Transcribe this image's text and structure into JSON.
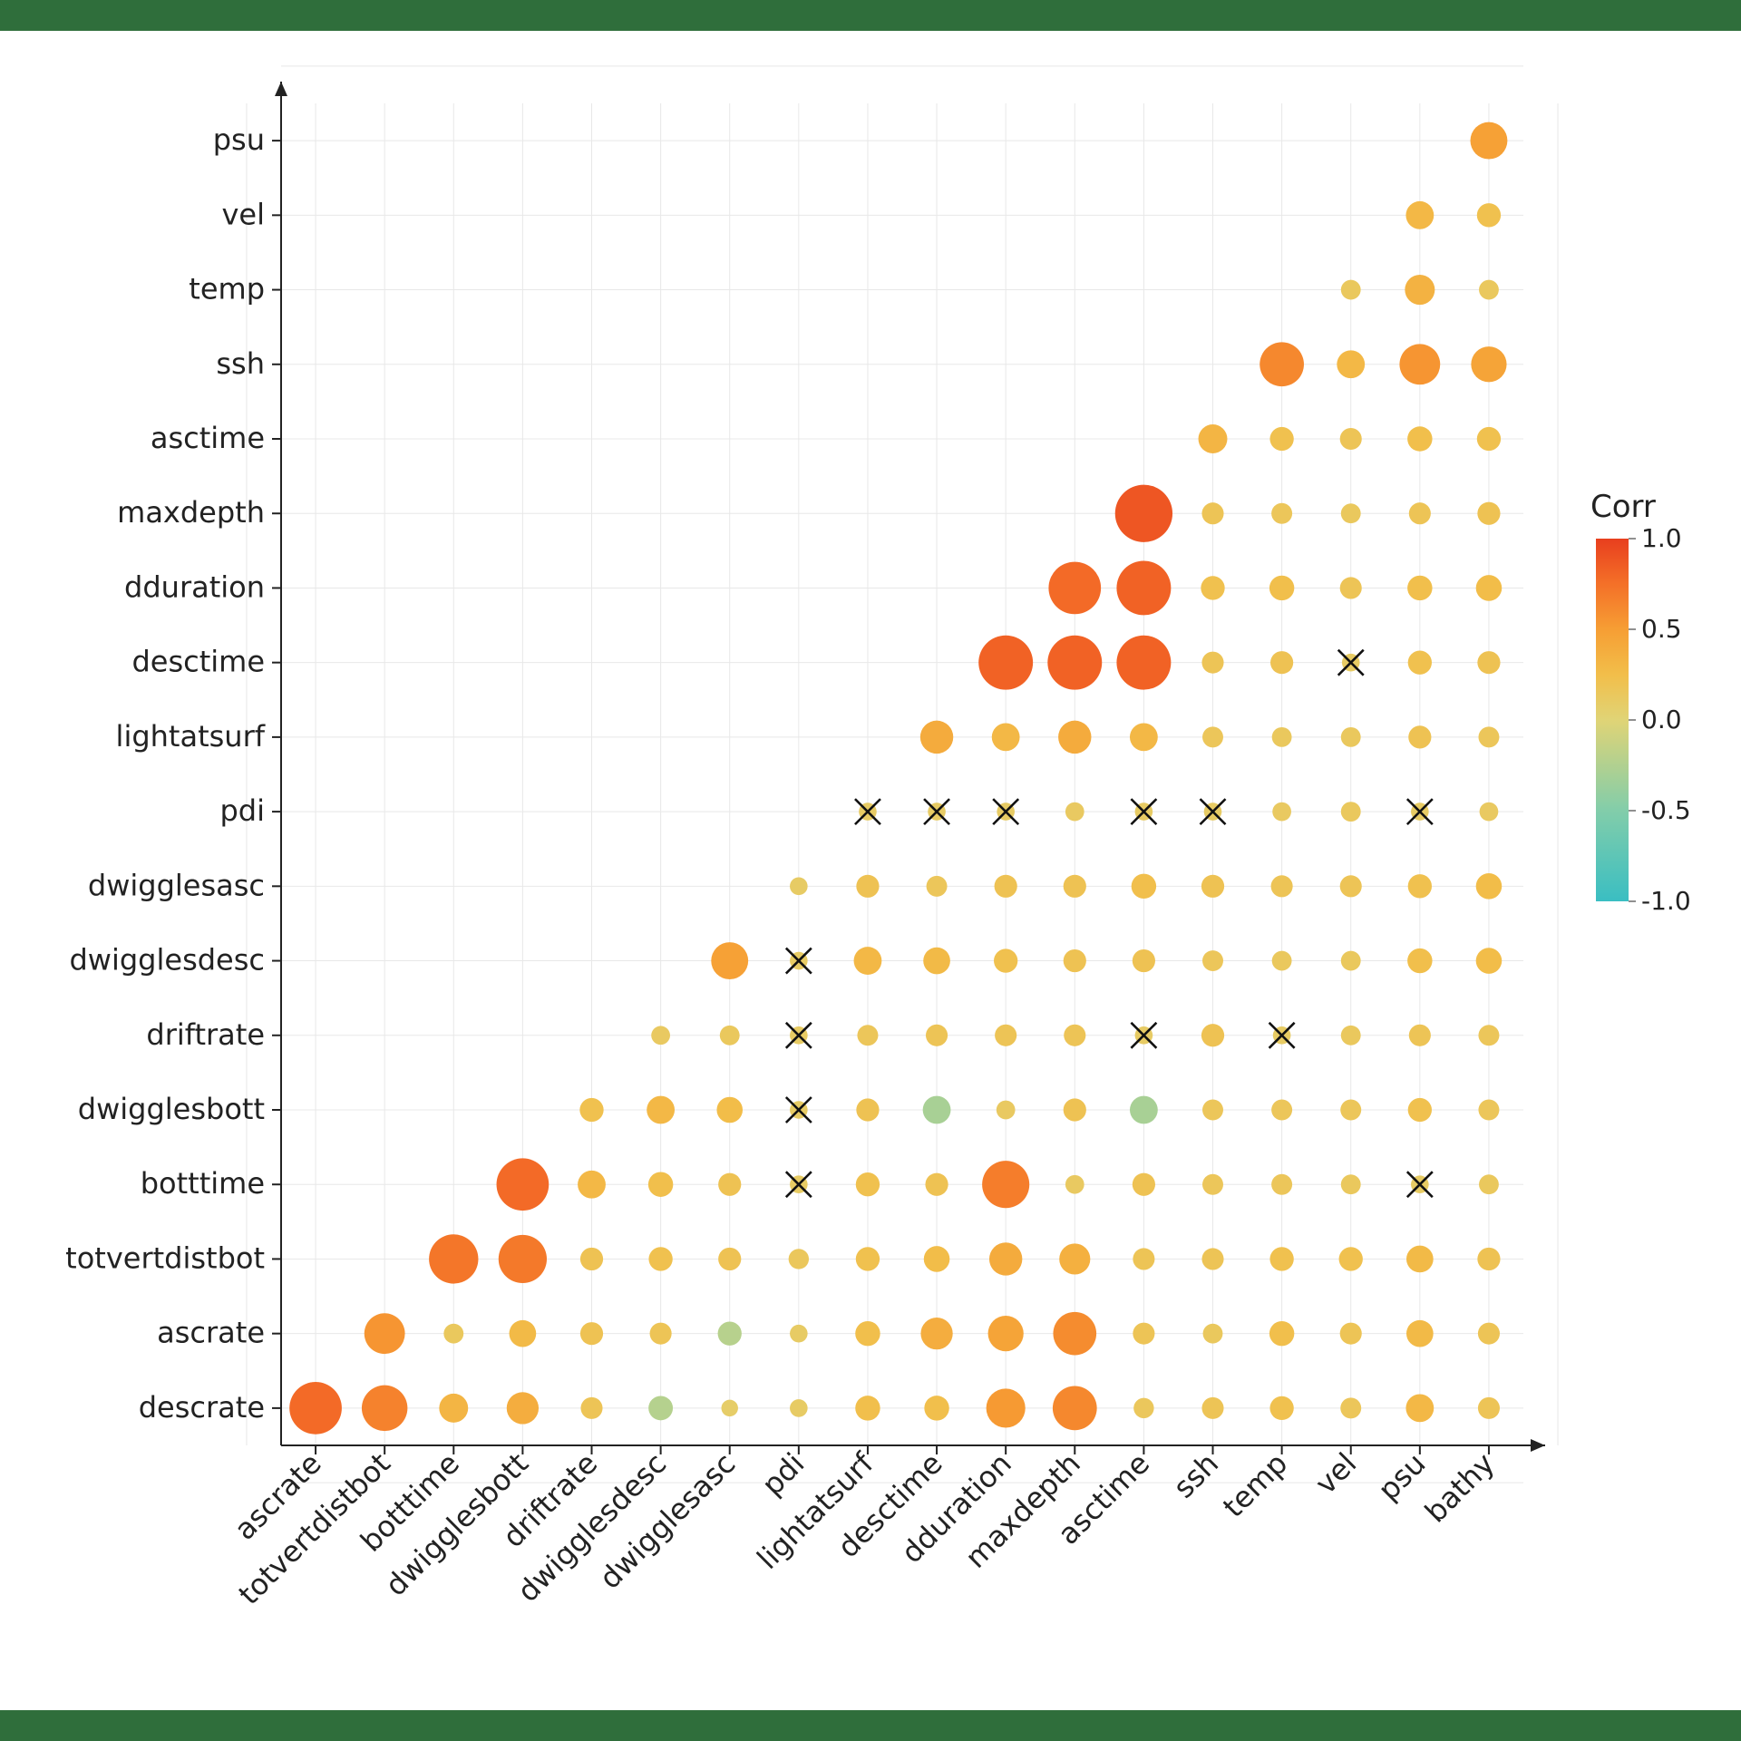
{
  "chart_data": {
    "type": "heatmap",
    "title": "",
    "xlabel": "",
    "ylabel": "",
    "legend_title": "Corr",
    "colorbar_ticks": [
      -1.0,
      -0.5,
      0.0,
      0.5,
      1.0
    ],
    "size_range_abs": [
      0.0,
      1.0
    ],
    "x_categories": [
      "ascrate",
      "totvertdistbot",
      "botttime",
      "dwigglesbott",
      "driftrate",
      "dwigglesdesc",
      "dwigglesasc",
      "pdi",
      "lightatsurf",
      "desctime",
      "dduration",
      "maxdepth",
      "asctime",
      "ssh",
      "temp",
      "vel",
      "psu",
      "bathy"
    ],
    "y_categories": [
      "descrate",
      "ascrate",
      "totvertdistbot",
      "botttime",
      "dwigglesbott",
      "driftrate",
      "dwigglesdesc",
      "dwigglesasc",
      "pdi",
      "lightatsurf",
      "desctime",
      "dduration",
      "maxdepth",
      "asctime",
      "ssh",
      "temp",
      "vel",
      "psu"
    ],
    "cells": [
      {
        "x": "ascrate",
        "y": "descrate",
        "v": 0.78
      },
      {
        "x": "totvertdistbot",
        "y": "descrate",
        "v": 0.65
      },
      {
        "x": "botttime",
        "y": "descrate",
        "v": 0.32
      },
      {
        "x": "dwigglesbott",
        "y": "descrate",
        "v": 0.38
      },
      {
        "x": "driftrate",
        "y": "descrate",
        "v": 0.18
      },
      {
        "x": "dwigglesdesc",
        "y": "descrate",
        "v": -0.23
      },
      {
        "x": "dwigglesasc",
        "y": "descrate",
        "v": 0.08
      },
      {
        "x": "pdi",
        "y": "descrate",
        "v": 0.1
      },
      {
        "x": "lightatsurf",
        "y": "descrate",
        "v": 0.24
      },
      {
        "x": "desctime",
        "y": "descrate",
        "v": 0.24
      },
      {
        "x": "dduration",
        "y": "descrate",
        "v": 0.52
      },
      {
        "x": "maxdepth",
        "y": "descrate",
        "v": 0.62
      },
      {
        "x": "asctime",
        "y": "descrate",
        "v": 0.15
      },
      {
        "x": "ssh",
        "y": "descrate",
        "v": 0.18
      },
      {
        "x": "temp",
        "y": "descrate",
        "v": 0.22
      },
      {
        "x": "vel",
        "y": "descrate",
        "v": 0.16
      },
      {
        "x": "psu",
        "y": "descrate",
        "v": 0.3
      },
      {
        "x": "bathy",
        "y": "descrate",
        "v": 0.18
      },
      {
        "x": "totvertdistbot",
        "y": "ascrate",
        "v": 0.55
      },
      {
        "x": "botttime",
        "y": "ascrate",
        "v": 0.14
      },
      {
        "x": "dwigglesbott",
        "y": "ascrate",
        "v": 0.28
      },
      {
        "x": "driftrate",
        "y": "ascrate",
        "v": 0.2
      },
      {
        "x": "dwigglesdesc",
        "y": "ascrate",
        "v": 0.18
      },
      {
        "x": "dwigglesasc",
        "y": "ascrate",
        "v": -0.22
      },
      {
        "x": "pdi",
        "y": "ascrate",
        "v": 0.1
      },
      {
        "x": "lightatsurf",
        "y": "ascrate",
        "v": 0.24
      },
      {
        "x": "desctime",
        "y": "ascrate",
        "v": 0.38
      },
      {
        "x": "dduration",
        "y": "ascrate",
        "v": 0.45
      },
      {
        "x": "maxdepth",
        "y": "ascrate",
        "v": 0.6
      },
      {
        "x": "asctime",
        "y": "ascrate",
        "v": 0.18
      },
      {
        "x": "ssh",
        "y": "ascrate",
        "v": 0.14
      },
      {
        "x": "temp",
        "y": "ascrate",
        "v": 0.24
      },
      {
        "x": "vel",
        "y": "ascrate",
        "v": 0.18
      },
      {
        "x": "psu",
        "y": "ascrate",
        "v": 0.28
      },
      {
        "x": "bathy",
        "y": "ascrate",
        "v": 0.18
      },
      {
        "x": "botttime",
        "y": "totvertdistbot",
        "v": 0.72
      },
      {
        "x": "dwigglesbott",
        "y": "totvertdistbot",
        "v": 0.7
      },
      {
        "x": "driftrate",
        "y": "totvertdistbot",
        "v": 0.2
      },
      {
        "x": "dwigglesdesc",
        "y": "totvertdistbot",
        "v": 0.22
      },
      {
        "x": "dwigglesasc",
        "y": "totvertdistbot",
        "v": 0.2
      },
      {
        "x": "pdi",
        "y": "totvertdistbot",
        "v": 0.15
      },
      {
        "x": "lightatsurf",
        "y": "totvertdistbot",
        "v": 0.22
      },
      {
        "x": "desctime",
        "y": "totvertdistbot",
        "v": 0.26
      },
      {
        "x": "dduration",
        "y": "totvertdistbot",
        "v": 0.4
      },
      {
        "x": "maxdepth",
        "y": "totvertdistbot",
        "v": 0.36
      },
      {
        "x": "asctime",
        "y": "totvertdistbot",
        "v": 0.18
      },
      {
        "x": "ssh",
        "y": "totvertdistbot",
        "v": 0.18
      },
      {
        "x": "temp",
        "y": "totvertdistbot",
        "v": 0.22
      },
      {
        "x": "vel",
        "y": "totvertdistbot",
        "v": 0.22
      },
      {
        "x": "psu",
        "y": "totvertdistbot",
        "v": 0.28
      },
      {
        "x": "bathy",
        "y": "totvertdistbot",
        "v": 0.2
      },
      {
        "x": "dwigglesbott",
        "y": "botttime",
        "v": 0.78
      },
      {
        "x": "driftrate",
        "y": "botttime",
        "v": 0.3
      },
      {
        "x": "dwigglesdesc",
        "y": "botttime",
        "v": 0.24
      },
      {
        "x": "dwigglesasc",
        "y": "botttime",
        "v": 0.2
      },
      {
        "x": "pdi",
        "y": "botttime",
        "v": 0.1,
        "ns": true
      },
      {
        "x": "lightatsurf",
        "y": "botttime",
        "v": 0.22
      },
      {
        "x": "desctime",
        "y": "botttime",
        "v": 0.2
      },
      {
        "x": "dduration",
        "y": "botttime",
        "v": 0.68
      },
      {
        "x": "maxdepth",
        "y": "botttime",
        "v": 0.12
      },
      {
        "x": "asctime",
        "y": "botttime",
        "v": 0.2
      },
      {
        "x": "ssh",
        "y": "botttime",
        "v": 0.16
      },
      {
        "x": "temp",
        "y": "botttime",
        "v": 0.16
      },
      {
        "x": "vel",
        "y": "botttime",
        "v": 0.14
      },
      {
        "x": "psu",
        "y": "botttime",
        "v": 0.1,
        "ns": true
      },
      {
        "x": "bathy",
        "y": "botttime",
        "v": 0.14
      },
      {
        "x": "driftrate",
        "y": "dwigglesbott",
        "v": 0.22
      },
      {
        "x": "dwigglesdesc",
        "y": "dwigglesbott",
        "v": 0.3
      },
      {
        "x": "dwigglesasc",
        "y": "dwigglesbott",
        "v": 0.26
      },
      {
        "x": "pdi",
        "y": "dwigglesbott",
        "v": 0.1,
        "ns": true
      },
      {
        "x": "lightatsurf",
        "y": "dwigglesbott",
        "v": 0.2
      },
      {
        "x": "desctime",
        "y": "dwigglesbott",
        "v": -0.3
      },
      {
        "x": "dduration",
        "y": "dwigglesbott",
        "v": 0.12
      },
      {
        "x": "maxdepth",
        "y": "dwigglesbott",
        "v": 0.2
      },
      {
        "x": "asctime",
        "y": "dwigglesbott",
        "v": -0.3
      },
      {
        "x": "ssh",
        "y": "dwigglesbott",
        "v": 0.16
      },
      {
        "x": "temp",
        "y": "dwigglesbott",
        "v": 0.16
      },
      {
        "x": "vel",
        "y": "dwigglesbott",
        "v": 0.16
      },
      {
        "x": "psu",
        "y": "dwigglesbott",
        "v": 0.22
      },
      {
        "x": "bathy",
        "y": "dwigglesbott",
        "v": 0.16
      },
      {
        "x": "dwigglesdesc",
        "y": "driftrate",
        "v": 0.12
      },
      {
        "x": "dwigglesasc",
        "y": "driftrate",
        "v": 0.14
      },
      {
        "x": "pdi",
        "y": "driftrate",
        "v": 0.1,
        "ns": true
      },
      {
        "x": "lightatsurf",
        "y": "driftrate",
        "v": 0.16
      },
      {
        "x": "desctime",
        "y": "driftrate",
        "v": 0.18
      },
      {
        "x": "dduration",
        "y": "driftrate",
        "v": 0.18
      },
      {
        "x": "maxdepth",
        "y": "driftrate",
        "v": 0.18
      },
      {
        "x": "asctime",
        "y": "driftrate",
        "v": 0.1,
        "ns": true
      },
      {
        "x": "ssh",
        "y": "driftrate",
        "v": 0.2
      },
      {
        "x": "temp",
        "y": "driftrate",
        "v": 0.1,
        "ns": true
      },
      {
        "x": "vel",
        "y": "driftrate",
        "v": 0.14
      },
      {
        "x": "psu",
        "y": "driftrate",
        "v": 0.18
      },
      {
        "x": "bathy",
        "y": "driftrate",
        "v": 0.16
      },
      {
        "x": "dwigglesasc",
        "y": "dwigglesdesc",
        "v": 0.48
      },
      {
        "x": "pdi",
        "y": "dwigglesdesc",
        "v": 0.1,
        "ns": true
      },
      {
        "x": "lightatsurf",
        "y": "dwigglesdesc",
        "v": 0.3
      },
      {
        "x": "desctime",
        "y": "dwigglesdesc",
        "v": 0.28
      },
      {
        "x": "dduration",
        "y": "dwigglesdesc",
        "v": 0.22
      },
      {
        "x": "maxdepth",
        "y": "dwigglesdesc",
        "v": 0.2
      },
      {
        "x": "asctime",
        "y": "dwigglesdesc",
        "v": 0.2
      },
      {
        "x": "ssh",
        "y": "dwigglesdesc",
        "v": 0.16
      },
      {
        "x": "temp",
        "y": "dwigglesdesc",
        "v": 0.14
      },
      {
        "x": "vel",
        "y": "dwigglesdesc",
        "v": 0.14
      },
      {
        "x": "psu",
        "y": "dwigglesdesc",
        "v": 0.24
      },
      {
        "x": "bathy",
        "y": "dwigglesdesc",
        "v": 0.26
      },
      {
        "x": "pdi",
        "y": "dwigglesasc",
        "v": 0.1
      },
      {
        "x": "lightatsurf",
        "y": "dwigglesasc",
        "v": 0.2
      },
      {
        "x": "desctime",
        "y": "dwigglesasc",
        "v": 0.16
      },
      {
        "x": "dduration",
        "y": "dwigglesasc",
        "v": 0.2
      },
      {
        "x": "maxdepth",
        "y": "dwigglesasc",
        "v": 0.2
      },
      {
        "x": "asctime",
        "y": "dwigglesasc",
        "v": 0.24
      },
      {
        "x": "ssh",
        "y": "dwigglesasc",
        "v": 0.2
      },
      {
        "x": "temp",
        "y": "dwigglesasc",
        "v": 0.18
      },
      {
        "x": "vel",
        "y": "dwigglesasc",
        "v": 0.18
      },
      {
        "x": "psu",
        "y": "dwigglesasc",
        "v": 0.22
      },
      {
        "x": "bathy",
        "y": "dwigglesasc",
        "v": 0.26
      },
      {
        "x": "lightatsurf",
        "y": "pdi",
        "v": 0.1,
        "ns": true
      },
      {
        "x": "desctime",
        "y": "pdi",
        "v": 0.1,
        "ns": true
      },
      {
        "x": "dduration",
        "y": "pdi",
        "v": 0.1,
        "ns": true
      },
      {
        "x": "maxdepth",
        "y": "pdi",
        "v": 0.12
      },
      {
        "x": "asctime",
        "y": "pdi",
        "v": 0.1,
        "ns": true
      },
      {
        "x": "ssh",
        "y": "pdi",
        "v": 0.1,
        "ns": true
      },
      {
        "x": "temp",
        "y": "pdi",
        "v": 0.12
      },
      {
        "x": "vel",
        "y": "pdi",
        "v": 0.14
      },
      {
        "x": "psu",
        "y": "pdi",
        "v": 0.1,
        "ns": true
      },
      {
        "x": "bathy",
        "y": "pdi",
        "v": 0.12
      },
      {
        "x": "desctime",
        "y": "lightatsurf",
        "v": 0.4
      },
      {
        "x": "dduration",
        "y": "lightatsurf",
        "v": 0.3
      },
      {
        "x": "maxdepth",
        "y": "lightatsurf",
        "v": 0.4
      },
      {
        "x": "asctime",
        "y": "lightatsurf",
        "v": 0.3
      },
      {
        "x": "ssh",
        "y": "lightatsurf",
        "v": 0.16
      },
      {
        "x": "temp",
        "y": "lightatsurf",
        "v": 0.14
      },
      {
        "x": "vel",
        "y": "lightatsurf",
        "v": 0.14
      },
      {
        "x": "psu",
        "y": "lightatsurf",
        "v": 0.2
      },
      {
        "x": "bathy",
        "y": "lightatsurf",
        "v": 0.16
      },
      {
        "x": "dduration",
        "y": "desctime",
        "v": 0.82
      },
      {
        "x": "maxdepth",
        "y": "desctime",
        "v": 0.82
      },
      {
        "x": "asctime",
        "y": "desctime",
        "v": 0.82
      },
      {
        "x": "ssh",
        "y": "desctime",
        "v": 0.18
      },
      {
        "x": "temp",
        "y": "desctime",
        "v": 0.2
      },
      {
        "x": "vel",
        "y": "desctime",
        "v": 0.1,
        "ns": true
      },
      {
        "x": "psu",
        "y": "desctime",
        "v": 0.22
      },
      {
        "x": "bathy",
        "y": "desctime",
        "v": 0.2
      },
      {
        "x": "maxdepth",
        "y": "dduration",
        "v": 0.78
      },
      {
        "x": "asctime",
        "y": "dduration",
        "v": 0.82
      },
      {
        "x": "ssh",
        "y": "dduration",
        "v": 0.22
      },
      {
        "x": "temp",
        "y": "dduration",
        "v": 0.24
      },
      {
        "x": "vel",
        "y": "dduration",
        "v": 0.18
      },
      {
        "x": "psu",
        "y": "dduration",
        "v": 0.24
      },
      {
        "x": "bathy",
        "y": "dduration",
        "v": 0.26
      },
      {
        "x": "asctime",
        "y": "maxdepth",
        "v": 0.88
      },
      {
        "x": "ssh",
        "y": "maxdepth",
        "v": 0.18
      },
      {
        "x": "temp",
        "y": "maxdepth",
        "v": 0.16
      },
      {
        "x": "vel",
        "y": "maxdepth",
        "v": 0.14
      },
      {
        "x": "psu",
        "y": "maxdepth",
        "v": 0.18
      },
      {
        "x": "bathy",
        "y": "maxdepth",
        "v": 0.2
      },
      {
        "x": "ssh",
        "y": "asctime",
        "v": 0.32
      },
      {
        "x": "temp",
        "y": "asctime",
        "v": 0.22
      },
      {
        "x": "vel",
        "y": "asctime",
        "v": 0.18
      },
      {
        "x": "psu",
        "y": "asctime",
        "v": 0.24
      },
      {
        "x": "bathy",
        "y": "asctime",
        "v": 0.22
      },
      {
        "x": "temp",
        "y": "ssh",
        "v": 0.62
      },
      {
        "x": "vel",
        "y": "ssh",
        "v": 0.3
      },
      {
        "x": "psu",
        "y": "ssh",
        "v": 0.55
      },
      {
        "x": "bathy",
        "y": "ssh",
        "v": 0.45
      },
      {
        "x": "vel",
        "y": "temp",
        "v": 0.14
      },
      {
        "x": "psu",
        "y": "temp",
        "v": 0.34
      },
      {
        "x": "bathy",
        "y": "temp",
        "v": 0.14
      },
      {
        "x": "psu",
        "y": "vel",
        "v": 0.3
      },
      {
        "x": "bathy",
        "y": "vel",
        "v": 0.22
      },
      {
        "x": "bathy",
        "y": "psu",
        "v": 0.48
      }
    ]
  }
}
